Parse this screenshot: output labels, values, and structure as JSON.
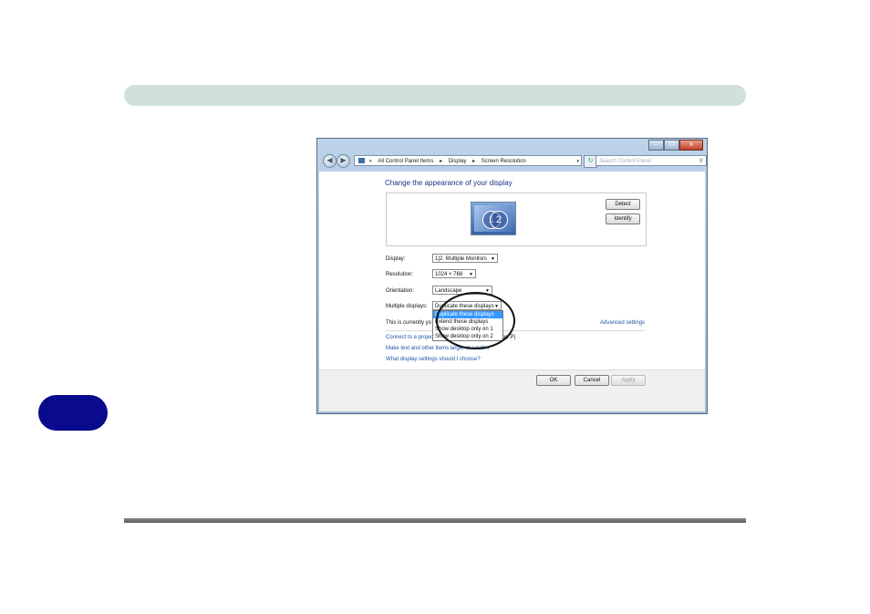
{
  "window": {
    "controls": {
      "minimize": "–",
      "maximize": "□",
      "close": "x"
    },
    "address": {
      "prefix": "«",
      "crumbs": [
        "All Control Panel Items",
        "▸",
        "Display",
        "▸",
        "Screen Resolution"
      ],
      "dropdown": "▾"
    },
    "search_placeholder": "Search Control Panel",
    "nav": {
      "back": "◀",
      "forward": "▶",
      "refresh": "↻"
    }
  },
  "screen_resolution": {
    "heading": "Change the appearance of your display",
    "detect_button": "Detect",
    "identify_button": "Identify",
    "monitor_numbers": [
      "1",
      "2"
    ],
    "fields": {
      "display": {
        "label": "Display:",
        "value": "1|2. Multiple Monitors"
      },
      "resolution": {
        "label": "Resolution:",
        "value": "1024 × 768"
      },
      "orientation": {
        "label": "Orientation:",
        "value": "Landscape"
      },
      "multiple_displays": {
        "label": "Multiple displays:",
        "value": "Duplicate these displays"
      }
    },
    "dropdown_options": [
      "Duplicate these displays",
      "Extend these displays",
      "Show desktop only on 1",
      "Show desktop only on 2"
    ],
    "current_text": "This is currently yo",
    "advanced_link": "Advanced settings",
    "links": {
      "connect_projector": "Connect to a projecto",
      "connect_projector_tail": "ap P)",
      "text_larger": "Make text and other items larger or smaller",
      "which_settings": "What display settings should I choose?"
    },
    "buttons": {
      "ok": "OK",
      "cancel": "Cancel",
      "apply": "Apply"
    }
  }
}
